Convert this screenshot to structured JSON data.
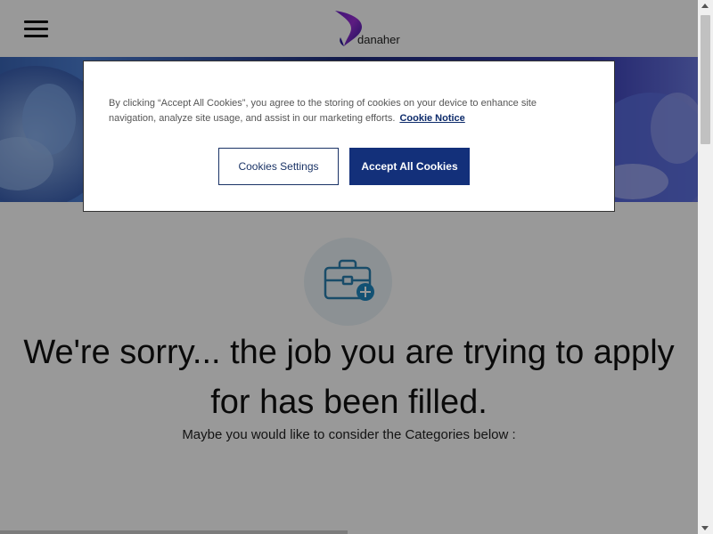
{
  "header": {
    "logo_text": "danaher",
    "menu_icon": "hamburger-menu-icon",
    "brand_colors": [
      "#2f1a9e",
      "#8a2be2",
      "#c040c8"
    ]
  },
  "main": {
    "icon": "briefcase-plus-icon",
    "heading": "We're sorry... the job you are trying to apply for has been filled.",
    "subheading": "Maybe you would like to consider the Categories below :"
  },
  "cookie_banner": {
    "text": "By clicking “Accept All Cookies”, you agree to the storing of cookies on your device to enhance site navigation, analyze site usage, and assist in our marketing efforts.",
    "link_label": "Cookie Notice",
    "settings_button": "Cookies Settings",
    "accept_button": "Accept All Cookies",
    "accent_color": "#13307a"
  },
  "colors": {
    "icon_stroke": "#2a7fb0",
    "icon_bg": "#e9f2f7",
    "overlay": "rgba(0,0,0,0.40)"
  }
}
